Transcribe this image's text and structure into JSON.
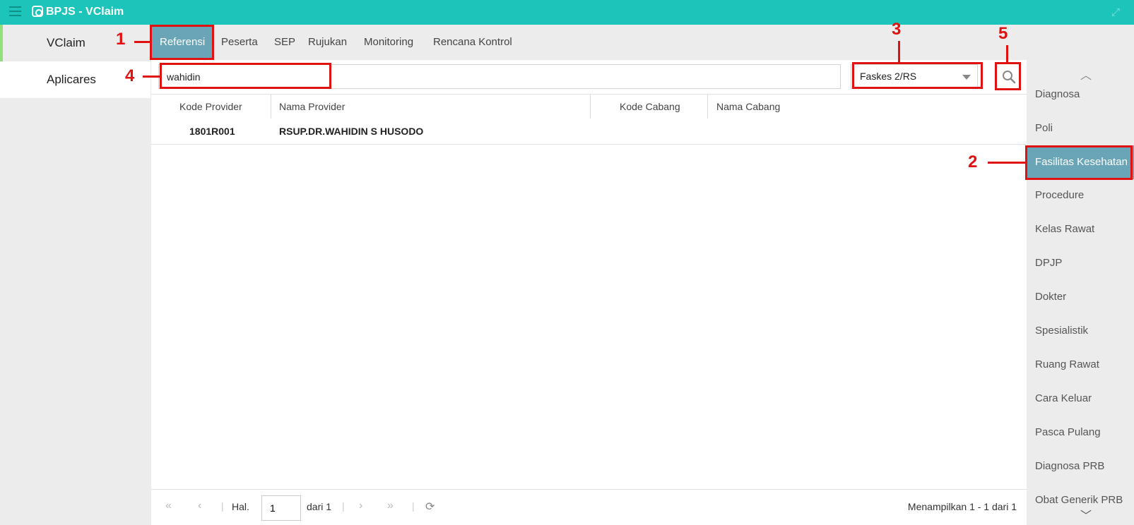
{
  "app": {
    "title": "BPJS - VClaim"
  },
  "sidebar": {
    "items": [
      {
        "label": "VClaim"
      },
      {
        "label": "Aplicares"
      }
    ]
  },
  "tabs": [
    {
      "label": "Referensi"
    },
    {
      "label": "Peserta"
    },
    {
      "label": "SEP"
    },
    {
      "label": "Rujukan"
    },
    {
      "label": "Monitoring"
    },
    {
      "label": "Rencana Kontrol"
    }
  ],
  "search": {
    "value": "wahidin",
    "select_value": "Faskes 2/RS"
  },
  "grid": {
    "columns": [
      "Kode Provider",
      "Nama Provider",
      "Kode Cabang",
      "Nama Cabang"
    ],
    "rows": [
      {
        "kode_provider": "1801R001",
        "nama_provider": "RSUP.DR.WAHIDIN S HUSODO",
        "kode_cabang": "",
        "nama_cabang": ""
      }
    ]
  },
  "pager": {
    "hal_label": "Hal.",
    "page": "1",
    "of_label": "dari 1",
    "info": "Menampilkan 1 - 1 dari 1"
  },
  "rightmenu": {
    "items": [
      "Diagnosa",
      "Poli",
      "Fasilitas Kesehatan",
      "Procedure",
      "Kelas Rawat",
      "DPJP",
      "Dokter",
      "Spesialistik",
      "Ruang Rawat",
      "Cara Keluar",
      "Pasca Pulang",
      "Diagnosa PRB",
      "Obat Generik PRB"
    ],
    "active": "Fasilitas Kesehatan"
  },
  "annotations": {
    "n1": "1",
    "n2": "2",
    "n3": "3",
    "n4": "4",
    "n5": "5",
    "color": "#e01111"
  },
  "colors": {
    "titlebar": "#1cc4b9",
    "active_tab": "#69a5b6",
    "accent_green": "#8fe27a"
  }
}
